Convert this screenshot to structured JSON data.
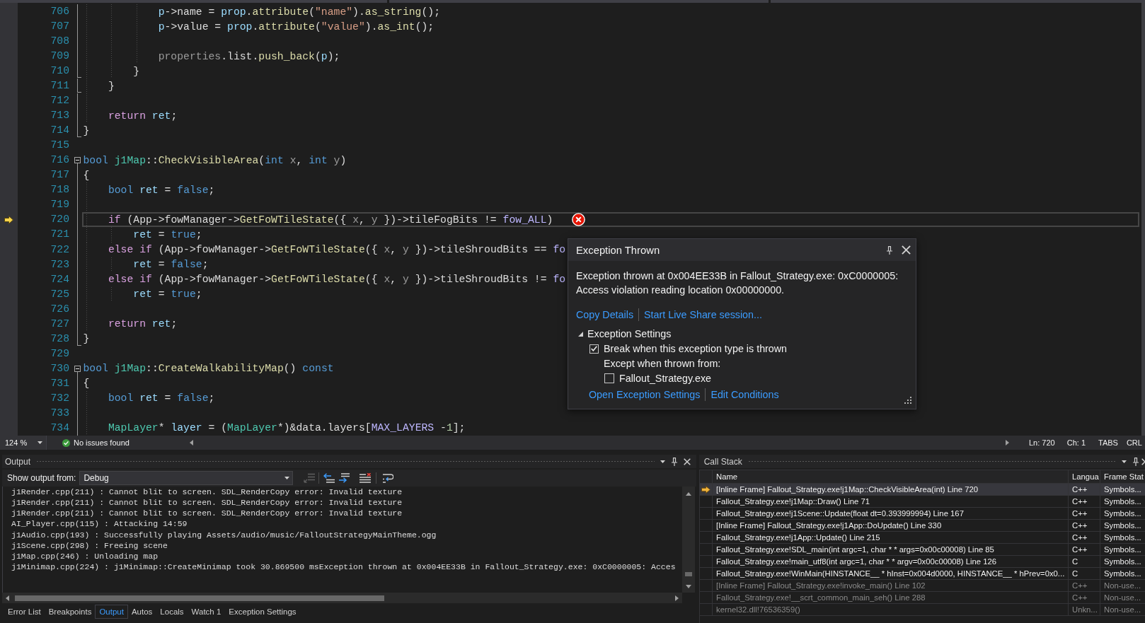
{
  "editor": {
    "lines": [
      {
        "number": "706",
        "kind": "plain",
        "current": false,
        "tokens": [
          {
            "kind": "local",
            "text": "            p"
          },
          {
            "kind": "plain",
            "text": "->name = "
          },
          {
            "kind": "local",
            "text": "prop"
          },
          {
            "kind": "plain",
            "text": "."
          },
          {
            "kind": "function",
            "text": "attribute"
          },
          {
            "kind": "plain",
            "text": "("
          },
          {
            "kind": "string",
            "text": "\"name\""
          },
          {
            "kind": "plain",
            "text": ")."
          },
          {
            "kind": "function",
            "text": "as_string"
          },
          {
            "kind": "plain",
            "text": "();"
          }
        ]
      },
      {
        "number": "707",
        "kind": "plain",
        "current": false,
        "tokens": [
          {
            "kind": "local",
            "text": "            p"
          },
          {
            "kind": "plain",
            "text": "->value = "
          },
          {
            "kind": "local",
            "text": "prop"
          },
          {
            "kind": "plain",
            "text": "."
          },
          {
            "kind": "function",
            "text": "attribute"
          },
          {
            "kind": "plain",
            "text": "("
          },
          {
            "kind": "string",
            "text": "\"value\""
          },
          {
            "kind": "plain",
            "text": ")."
          },
          {
            "kind": "function",
            "text": "as_int"
          },
          {
            "kind": "plain",
            "text": "();"
          }
        ]
      },
      {
        "number": "708",
        "kind": "plain",
        "current": false
      },
      {
        "number": "709",
        "kind": "plain",
        "current": false,
        "tokens": [
          {
            "kind": "param",
            "text": "            properties"
          },
          {
            "kind": "plain",
            "text": ".list."
          },
          {
            "kind": "function",
            "text": "push_back"
          },
          {
            "kind": "plain",
            "text": "("
          },
          {
            "kind": "local",
            "text": "p"
          },
          {
            "kind": "plain",
            "text": ");"
          }
        ]
      },
      {
        "number": "710",
        "kind": "fold-end",
        "current": false,
        "tokens": [
          {
            "kind": "plain",
            "text": "        }"
          }
        ]
      },
      {
        "number": "711",
        "kind": "fold-end",
        "current": false,
        "tokens": [
          {
            "kind": "plain",
            "text": "    }"
          }
        ]
      },
      {
        "number": "712",
        "kind": "plain",
        "current": false
      },
      {
        "number": "713",
        "kind": "plain",
        "current": false,
        "tokens": [
          {
            "kind": "control",
            "text": "    return "
          },
          {
            "kind": "local",
            "text": "ret"
          },
          {
            "kind": "plain",
            "text": ";"
          }
        ]
      },
      {
        "number": "714",
        "kind": "fold-end",
        "current": false,
        "tokens": [
          {
            "kind": "plain",
            "text": "}"
          }
        ]
      },
      {
        "number": "715",
        "kind": "plain",
        "current": false
      },
      {
        "number": "716",
        "kind": "fold-start",
        "current": false,
        "tokens": [
          {
            "kind": "keyword",
            "text": "bool "
          },
          {
            "kind": "type",
            "text": "j1Map"
          },
          {
            "kind": "plain",
            "text": "::"
          },
          {
            "kind": "function",
            "text": "CheckVisibleArea"
          },
          {
            "kind": "plain",
            "text": "("
          },
          {
            "kind": "keyword",
            "text": "int "
          },
          {
            "kind": "param",
            "text": "x"
          },
          {
            "kind": "plain",
            "text": ", "
          },
          {
            "kind": "keyword",
            "text": "int "
          },
          {
            "kind": "param",
            "text": "y"
          },
          {
            "kind": "plain",
            "text": ")"
          }
        ]
      },
      {
        "number": "717",
        "kind": "plain",
        "current": false,
        "tokens": [
          {
            "kind": "plain",
            "text": "{"
          }
        ]
      },
      {
        "number": "718",
        "kind": "plain",
        "current": false,
        "tokens": [
          {
            "kind": "keyword",
            "text": "    bool "
          },
          {
            "kind": "local",
            "text": "ret"
          },
          {
            "kind": "plain",
            "text": " = "
          },
          {
            "kind": "keyword",
            "text": "false"
          },
          {
            "kind": "plain",
            "text": ";"
          }
        ]
      },
      {
        "number": "719",
        "kind": "plain",
        "current": false
      },
      {
        "number": "720",
        "kind": "plain",
        "current": true,
        "tokens": [
          {
            "kind": "control",
            "text": "    if"
          },
          {
            "kind": "plain",
            "text": " (App->fowManager->"
          },
          {
            "kind": "function",
            "text": "GetFoWTileState"
          },
          {
            "kind": "plain",
            "text": "({ "
          },
          {
            "kind": "param",
            "text": "x"
          },
          {
            "kind": "plain",
            "text": ", "
          },
          {
            "kind": "param",
            "text": "y"
          },
          {
            "kind": "plain",
            "text": " })->tileFogBits != "
          },
          {
            "kind": "macro",
            "text": "fow_ALL"
          },
          {
            "kind": "plain",
            "text": ")"
          }
        ]
      },
      {
        "number": "721",
        "kind": "plain",
        "current": false,
        "tokens": [
          {
            "kind": "local",
            "text": "        ret"
          },
          {
            "kind": "plain",
            "text": " = "
          },
          {
            "kind": "keyword",
            "text": "true"
          },
          {
            "kind": "plain",
            "text": ";"
          }
        ]
      },
      {
        "number": "722",
        "kind": "plain",
        "current": false,
        "tokens": [
          {
            "kind": "control",
            "text": "    else if"
          },
          {
            "kind": "plain",
            "text": " (App->fowManager->"
          },
          {
            "kind": "function",
            "text": "GetFoWTileState"
          },
          {
            "kind": "plain",
            "text": "({ "
          },
          {
            "kind": "param",
            "text": "x"
          },
          {
            "kind": "plain",
            "text": ", "
          },
          {
            "kind": "param",
            "text": "y"
          },
          {
            "kind": "plain",
            "text": " })->tileShroudBits == "
          },
          {
            "kind": "macro",
            "text": "fo"
          }
        ]
      },
      {
        "number": "723",
        "kind": "plain",
        "current": false,
        "tokens": [
          {
            "kind": "local",
            "text": "        ret"
          },
          {
            "kind": "plain",
            "text": " = "
          },
          {
            "kind": "keyword",
            "text": "false"
          },
          {
            "kind": "plain",
            "text": ";"
          }
        ]
      },
      {
        "number": "724",
        "kind": "plain",
        "current": false,
        "tokens": [
          {
            "kind": "control",
            "text": "    else if"
          },
          {
            "kind": "plain",
            "text": " (App->fowManager->"
          },
          {
            "kind": "function",
            "text": "GetFoWTileState"
          },
          {
            "kind": "plain",
            "text": "({ "
          },
          {
            "kind": "param",
            "text": "x"
          },
          {
            "kind": "plain",
            "text": ", "
          },
          {
            "kind": "param",
            "text": "y"
          },
          {
            "kind": "plain",
            "text": " })->tileShroudBits != "
          },
          {
            "kind": "macro",
            "text": "fo"
          }
        ]
      },
      {
        "number": "725",
        "kind": "plain",
        "current": false,
        "tokens": [
          {
            "kind": "local",
            "text": "        ret"
          },
          {
            "kind": "plain",
            "text": " = "
          },
          {
            "kind": "keyword",
            "text": "true"
          },
          {
            "kind": "plain",
            "text": ";"
          }
        ]
      },
      {
        "number": "726",
        "kind": "plain",
        "current": false
      },
      {
        "number": "727",
        "kind": "plain",
        "current": false,
        "tokens": [
          {
            "kind": "control",
            "text": "    return "
          },
          {
            "kind": "local",
            "text": "ret"
          },
          {
            "kind": "plain",
            "text": ";"
          }
        ]
      },
      {
        "number": "728",
        "kind": "fold-end",
        "current": false,
        "tokens": [
          {
            "kind": "plain",
            "text": "}"
          }
        ]
      },
      {
        "number": "729",
        "kind": "plain",
        "current": false
      },
      {
        "number": "730",
        "kind": "fold-start",
        "current": false,
        "tokens": [
          {
            "kind": "keyword",
            "text": "bool "
          },
          {
            "kind": "type",
            "text": "j1Map"
          },
          {
            "kind": "plain",
            "text": "::"
          },
          {
            "kind": "function",
            "text": "CreateWalkabilityMap"
          },
          {
            "kind": "plain",
            "text": "() "
          },
          {
            "kind": "keyword",
            "text": "const"
          }
        ]
      },
      {
        "number": "731",
        "kind": "plain",
        "current": false,
        "tokens": [
          {
            "kind": "plain",
            "text": "{"
          }
        ]
      },
      {
        "number": "732",
        "kind": "plain",
        "current": false,
        "tokens": [
          {
            "kind": "keyword",
            "text": "    bool "
          },
          {
            "kind": "local",
            "text": "ret"
          },
          {
            "kind": "plain",
            "text": " = "
          },
          {
            "kind": "keyword",
            "text": "false"
          },
          {
            "kind": "plain",
            "text": ";"
          }
        ]
      },
      {
        "number": "733",
        "kind": "plain",
        "current": false
      },
      {
        "number": "734",
        "kind": "plain",
        "current": false,
        "tokens": [
          {
            "kind": "type",
            "text": "    MapLayer"
          },
          {
            "kind": "plain",
            "text": "* "
          },
          {
            "kind": "local",
            "text": "layer"
          },
          {
            "kind": "plain",
            "text": " = ("
          },
          {
            "kind": "type",
            "text": "MapLayer"
          },
          {
            "kind": "plain",
            "text": "*)&data.layers["
          },
          {
            "kind": "macro",
            "text": "MAX_LAYERS"
          },
          {
            "kind": "plain",
            "text": " -"
          },
          {
            "kind": "number",
            "text": "1"
          },
          {
            "kind": "plain",
            "text": "];"
          }
        ]
      }
    ],
    "exception": {
      "title": "Exception Thrown",
      "message": "Exception thrown at 0x004EE33B in Fallout_Strategy.exe: 0xC0000005:\nAccess violation reading location 0x00000000.",
      "links": [
        "Copy Details",
        "Start Live Share session..."
      ],
      "settings": {
        "title": "Exception Settings",
        "expanded": true,
        "options": [
          {
            "label": "Break when this exception type is thrown",
            "checked": true
          }
        ],
        "except_label": "Except when thrown from:",
        "modules": [
          {
            "label": "Fallout_Strategy.exe",
            "checked": false
          }
        ],
        "links": [
          "Open Exception Settings",
          "Edit Conditions"
        ]
      }
    }
  },
  "status_bar": {
    "zoom": "124 %",
    "issues": "No issues found",
    "line": "Ln: 720",
    "column": "Ch: 1",
    "indentation": "TABS",
    "line_ending": "CRL"
  },
  "output_panel": {
    "title": "Output",
    "source_label": "Show output from:",
    "source": "Debug",
    "tools": [
      {
        "kind": "locate",
        "disabled": true
      },
      {
        "kind": "previous",
        "disabled": false
      },
      {
        "kind": "next",
        "disabled": false
      },
      {
        "kind": "clear",
        "disabled": false
      },
      {
        "kind": "wrap",
        "disabled": false
      }
    ],
    "lines": [
      "j1Render.cpp(211) : Cannot blit to screen. SDL_RenderCopy error: Invalid texture",
      "j1Render.cpp(211) : Cannot blit to screen. SDL_RenderCopy error: Invalid texture",
      "j1Render.cpp(211) : Cannot blit to screen. SDL_RenderCopy error: Invalid texture",
      "AI_Player.cpp(115) : Attacking 14:59",
      "j1Audio.cpp(193) : Successfully playing Assets/audio/music/FalloutStrategyMainTheme.ogg",
      "j1Scene.cpp(298) : Freeing scene",
      "j1Map.cpp(246) : Unloading map",
      "j1Minimap.cpp(224) : j1Minimap::CreateMinimap took 30.869500 msException thrown at 0x004EE33B in Fallout_Strategy.exe: 0xC0000005: Acces"
    ]
  },
  "panel_tabs": [
    {
      "label": "Error List",
      "selected": false
    },
    {
      "label": "Breakpoints",
      "selected": false
    },
    {
      "label": "Output",
      "selected": true
    },
    {
      "label": "Autos",
      "selected": false
    },
    {
      "label": "Locals",
      "selected": false
    },
    {
      "label": "Watch 1",
      "selected": false
    },
    {
      "label": "Exception Settings",
      "selected": false
    }
  ],
  "call_stack": {
    "title": "Call Stack",
    "columns": [
      "Name",
      "Langua",
      "Frame Stat"
    ],
    "rows": [
      {
        "cells": [
          "[Inline Frame] Fallout_Strategy.exe!j1Map::CheckVisibleArea(int) Line 720",
          "C++",
          "Symbols..."
        ],
        "current": true,
        "dimmed": false
      },
      {
        "cells": [
          "Fallout_Strategy.exe!j1Map::Draw() Line 71",
          "C++",
          "Symbols..."
        ],
        "current": false,
        "dimmed": false
      },
      {
        "cells": [
          "Fallout_Strategy.exe!j1Scene::Update(float dt=0.393999994) Line 167",
          "C++",
          "Symbols..."
        ],
        "current": false,
        "dimmed": false
      },
      {
        "cells": [
          "[Inline Frame] Fallout_Strategy.exe!j1App::DoUpdate() Line 330",
          "C++",
          "Symbols..."
        ],
        "current": false,
        "dimmed": false
      },
      {
        "cells": [
          "Fallout_Strategy.exe!j1App::Update() Line 215",
          "C++",
          "Symbols..."
        ],
        "current": false,
        "dimmed": false
      },
      {
        "cells": [
          "Fallout_Strategy.exe!SDL_main(int argc=1, char * * args=0x00c00008) Line 85",
          "C++",
          "Symbols..."
        ],
        "current": false,
        "dimmed": false
      },
      {
        "cells": [
          "Fallout_Strategy.exe!main_utf8(int argc=1, char * * argv=0x00c00008) Line 126",
          "C",
          "Symbols..."
        ],
        "current": false,
        "dimmed": false
      },
      {
        "cells": [
          "Fallout_Strategy.exe!WinMain(HINSTANCE__ * hInst=0x004d0000, HINSTANCE__ * hPrev=0x0...",
          "C",
          "Symbols..."
        ],
        "current": false,
        "dimmed": false
      },
      {
        "cells": [
          "[Inline Frame] Fallout_Strategy.exe!invoke_main() Line 102",
          "C++",
          "Non-use..."
        ],
        "current": false,
        "dimmed": true
      },
      {
        "cells": [
          "Fallout_Strategy.exe!__scrt_common_main_seh() Line 288",
          "C++",
          "Non-use..."
        ],
        "current": false,
        "dimmed": true
      },
      {
        "cells": [
          "kernel32.dll!76536359()",
          "Unkn...",
          "Non-use..."
        ],
        "current": false,
        "dimmed": true
      }
    ]
  }
}
